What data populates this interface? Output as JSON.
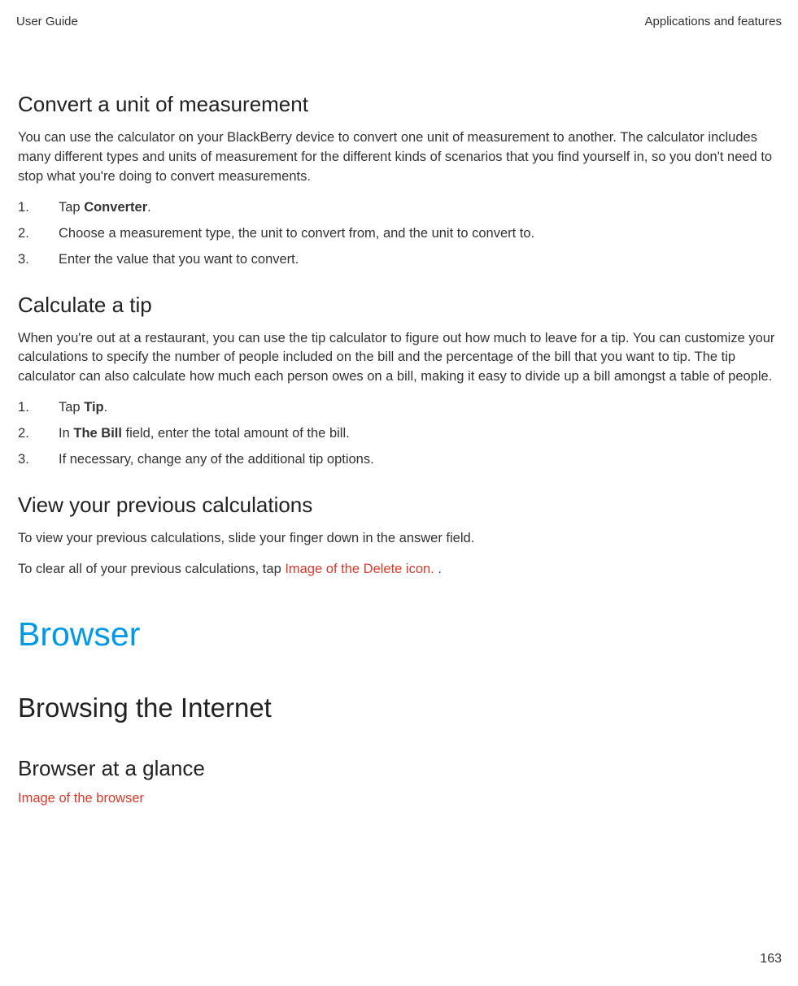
{
  "header": {
    "left": "User Guide",
    "right": "Applications and features"
  },
  "sections": {
    "convert": {
      "title": "Convert a unit of measurement",
      "body": "You can use the calculator on your BlackBerry device to convert one unit of measurement to another. The calculator includes many different types and units of measurement for the different kinds of scenarios that you find yourself in, so you don't need to stop what you're doing to convert measurements.",
      "step1_pre": "Tap ",
      "step1_bold": "Converter",
      "step1_post": ".",
      "step2": "Choose a measurement type, the unit to convert from, and the unit to convert to.",
      "step3": "Enter the value that you want to convert."
    },
    "tip": {
      "title": "Calculate a tip",
      "body": "When you're out at a restaurant, you can use the tip calculator to figure out how much to leave for a tip. You can customize your calculations to specify the number of people included on the bill and the percentage of the bill that you want to tip. The tip calculator can also calculate how much each person owes on a bill, making it easy to divide up a bill amongst a table of people.",
      "step1_pre": "Tap ",
      "step1_bold": "Tip",
      "step1_post": ".",
      "step2_pre": "In ",
      "step2_bold": "The Bill",
      "step2_post": " field, enter the total amount of the bill.",
      "step3": "If necessary, change any of the additional tip options."
    },
    "previous": {
      "title": "View your previous calculations",
      "body1": "To view your previous calculations, slide your finger down in the answer field.",
      "body2_pre": "To clear all of your previous calculations, tap  ",
      "body2_alt": "Image of the Delete icon.",
      "body2_post": " ."
    },
    "browser": {
      "chapter": "Browser",
      "sub": "Browsing the Internet",
      "glance_title": "Browser at a glance",
      "glance_image_alt": "Image of the browser"
    }
  },
  "page_number": "163"
}
